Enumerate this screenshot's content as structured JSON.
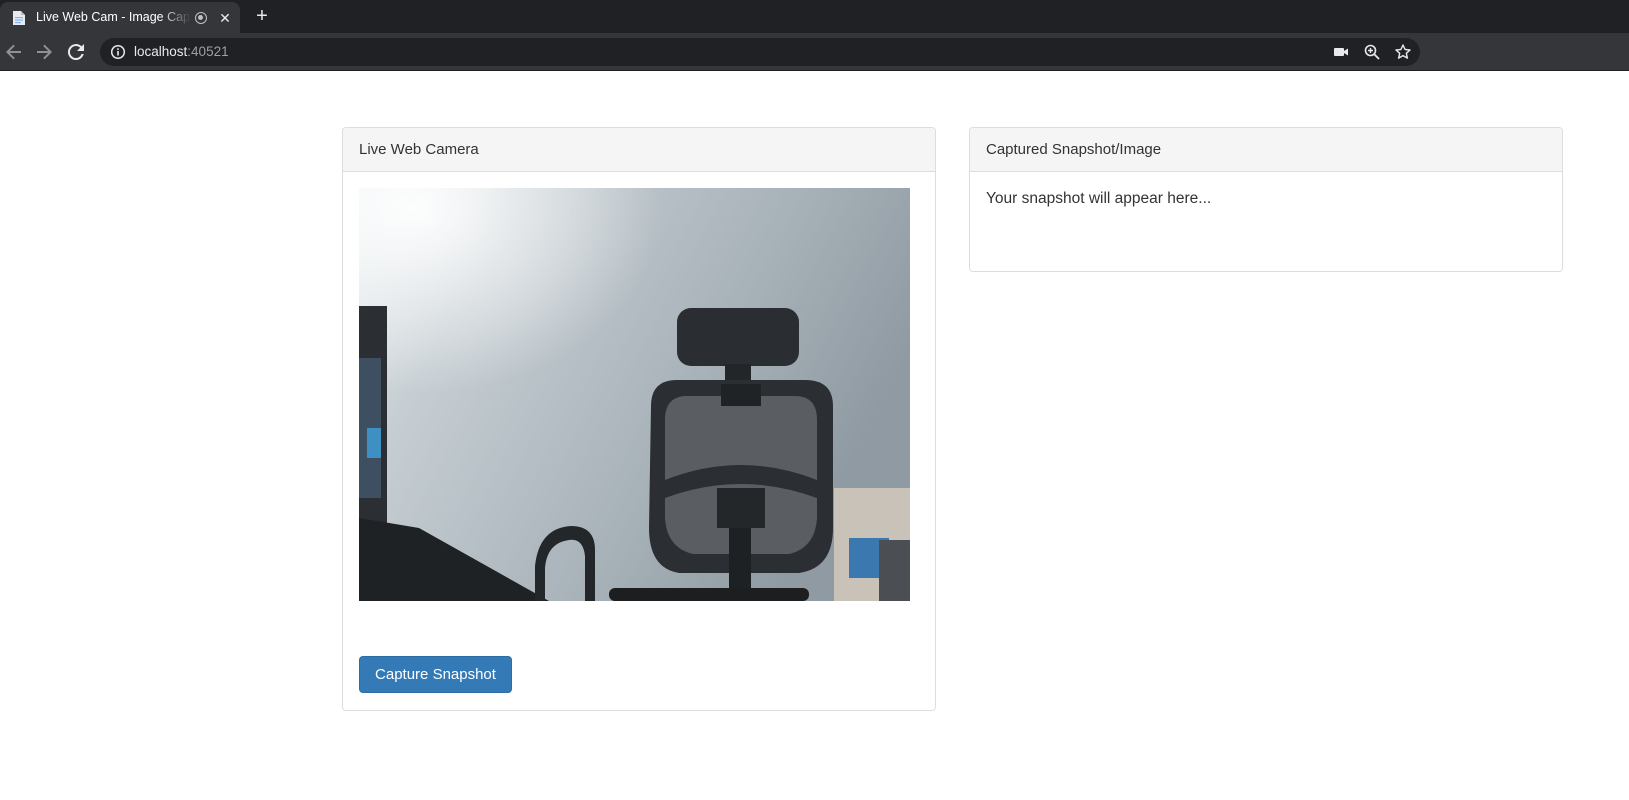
{
  "browser": {
    "tab_title": "Live Web Cam - Image Capture",
    "url_host": "localhost",
    "url_port": ":40521"
  },
  "camera_panel": {
    "heading": "Live Web Camera",
    "capture_button_label": "Capture Snapshot"
  },
  "snapshot_panel": {
    "heading": "Captured Snapshot/Image",
    "placeholder_text": "Your snapshot will appear here..."
  },
  "colors": {
    "primary_button": "#337ab7",
    "panel_heading_bg": "#f5f5f5",
    "chrome_dark": "#202124",
    "chrome_toolbar": "#35363a"
  }
}
